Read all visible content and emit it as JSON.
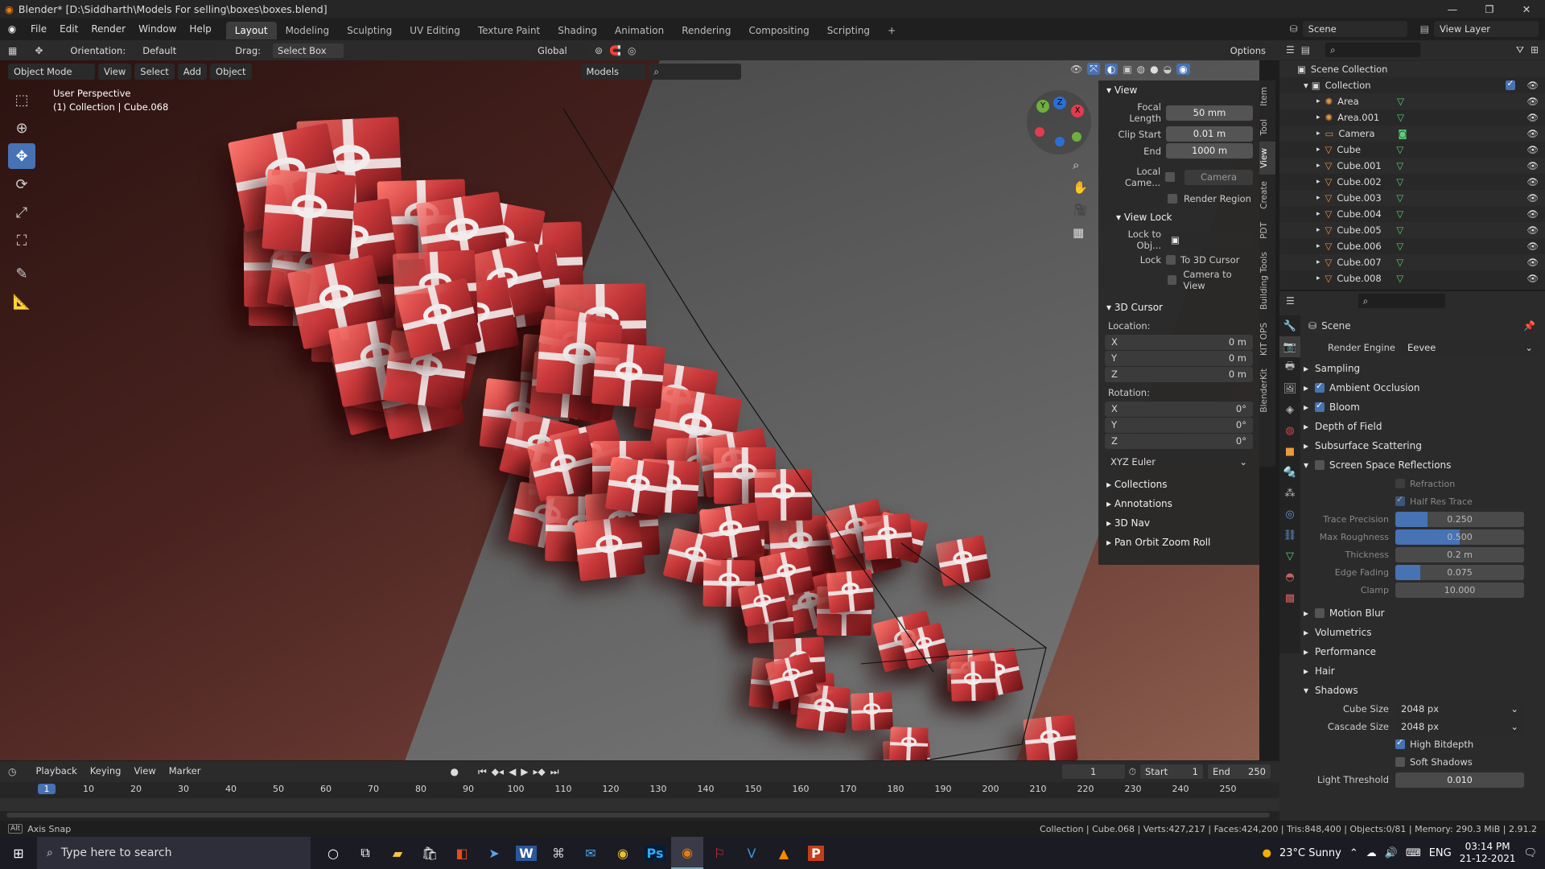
{
  "title": "Blender* [D:\\Siddharth\\Models For selling\\boxes\\boxes.blend]",
  "menus": [
    "File",
    "Edit",
    "Render",
    "Window",
    "Help"
  ],
  "workspaces": [
    "Layout",
    "Modeling",
    "Sculpting",
    "UV Editing",
    "Texture Paint",
    "Shading",
    "Animation",
    "Rendering",
    "Compositing",
    "Scripting"
  ],
  "scene_field": "Scene",
  "view_layer_field": "View Layer",
  "toolbar": {
    "orientation_label": "Orientation:",
    "orientation_value": "Default",
    "drag_label": "Drag:",
    "drag_value": "Select Box",
    "transform_space": "Global",
    "options": "Options"
  },
  "viewport_header": {
    "mode": "Object Mode",
    "menus": [
      "View",
      "Select",
      "Add",
      "Object"
    ],
    "models": "Models"
  },
  "viewport_overlay": {
    "line1": "User Perspective",
    "line2": "(1) Collection | Cube.068"
  },
  "gizmo_labels": {
    "x": "X",
    "y": "Y",
    "z": "Z"
  },
  "npanel": {
    "view_title": "View",
    "focal_length_label": "Focal Length",
    "focal_length": "50 mm",
    "clip_start_label": "Clip Start",
    "clip_start": "0.01 m",
    "end_label": "End",
    "end": "1000 m",
    "local_camera_label": "Local Came...",
    "local_camera_value": "Camera",
    "render_region": "Render Region",
    "view_lock_title": "View Lock",
    "lock_to_obj_label": "Lock to Obj...",
    "lock_label": "Lock",
    "to_3d_cursor": "To 3D Cursor",
    "camera_to_view": "Camera to View",
    "cursor_title": "3D Cursor",
    "location_label": "Location:",
    "location": [
      {
        "axis": "X",
        "value": "0 m"
      },
      {
        "axis": "Y",
        "value": "0 m"
      },
      {
        "axis": "Z",
        "value": "0 m"
      }
    ],
    "rotation_label": "Rotation:",
    "rotation": [
      {
        "axis": "X",
        "value": "0°"
      },
      {
        "axis": "Y",
        "value": "0°"
      },
      {
        "axis": "Z",
        "value": "0°"
      }
    ],
    "rotation_mode": "XYZ Euler",
    "collapsed": [
      "Collections",
      "Annotations",
      "3D Nav",
      "Pan Orbit Zoom Roll"
    ]
  },
  "side_tabs": [
    "Item",
    "Tool",
    "View",
    "Create",
    "PDT",
    "Building Tools",
    "KIT OPS",
    "BlenderKit"
  ],
  "outliner": {
    "root": "Scene Collection",
    "collection": "Collection",
    "items": [
      "Area",
      "Area.001",
      "Camera",
      "Cube",
      "Cube.001",
      "Cube.002",
      "Cube.003",
      "Cube.004",
      "Cube.005",
      "Cube.006",
      "Cube.007",
      "Cube.008"
    ]
  },
  "properties": {
    "scene": "Scene",
    "render_engine_label": "Render Engine",
    "render_engine": "Eevee",
    "sampling": "Sampling",
    "ambient_occlusion": "Ambient Occlusion",
    "bloom": "Bloom",
    "depth_of_field": "Depth of Field",
    "subsurface_scattering": "Subsurface Scattering",
    "ssr": "Screen Space Reflections",
    "refraction": "Refraction",
    "half_res_trace": "Half Res Trace",
    "trace_precision_label": "Trace Precision",
    "trace_precision": "0.250",
    "max_roughness_label": "Max Roughness",
    "max_roughness": "0.500",
    "thickness_label": "Thickness",
    "thickness": "0.2 m",
    "edge_fading_label": "Edge Fading",
    "edge_fading": "0.075",
    "clamp_label": "Clamp",
    "clamp": "10.000",
    "motion_blur": "Motion Blur",
    "volumetrics": "Volumetrics",
    "performance": "Performance",
    "hair": "Hair",
    "shadows": "Shadows",
    "cube_size_label": "Cube Size",
    "cube_size": "2048 px",
    "cascade_size_label": "Cascade Size",
    "cascade_size": "2048 px",
    "high_bitdepth": "High Bitdepth",
    "soft_shadows": "Soft Shadows",
    "light_threshold_label": "Light Threshold",
    "light_threshold": "0.010",
    "trace_precision_level": 0.25,
    "max_roughness_level": 0.5,
    "edge_fading_level": 0.075
  },
  "timeline": {
    "menus": [
      "Playback",
      "Keying",
      "View",
      "Marker"
    ],
    "current_frame": "1",
    "start_label": "Start",
    "start": "1",
    "end_label": "End",
    "end": "250",
    "ticks": [
      "1",
      "10",
      "20",
      "30",
      "40",
      "50",
      "60",
      "70",
      "80",
      "90",
      "100",
      "110",
      "120",
      "130",
      "140",
      "150",
      "160",
      "170",
      "180",
      "190",
      "200",
      "210",
      "220",
      "230",
      "240",
      "250"
    ]
  },
  "status": {
    "left": "Axis Snap",
    "right": "Collection | Cube.068 | Verts:427,217 | Faces:424,200 | Tris:848,400 | Objects:0/81 | Memory: 290.3 MiB | 2.91.2"
  },
  "taskbar": {
    "search": "Type here to search",
    "weather": "23°C  Sunny",
    "lang": "ENG",
    "time": "03:14 PM",
    "date": "21-12-2021",
    "apps": [
      "Ps",
      "W",
      "P"
    ]
  },
  "colors": {
    "accent": "#4772b3",
    "gift": "#c8383a",
    "ribbon": "#f2eded"
  }
}
